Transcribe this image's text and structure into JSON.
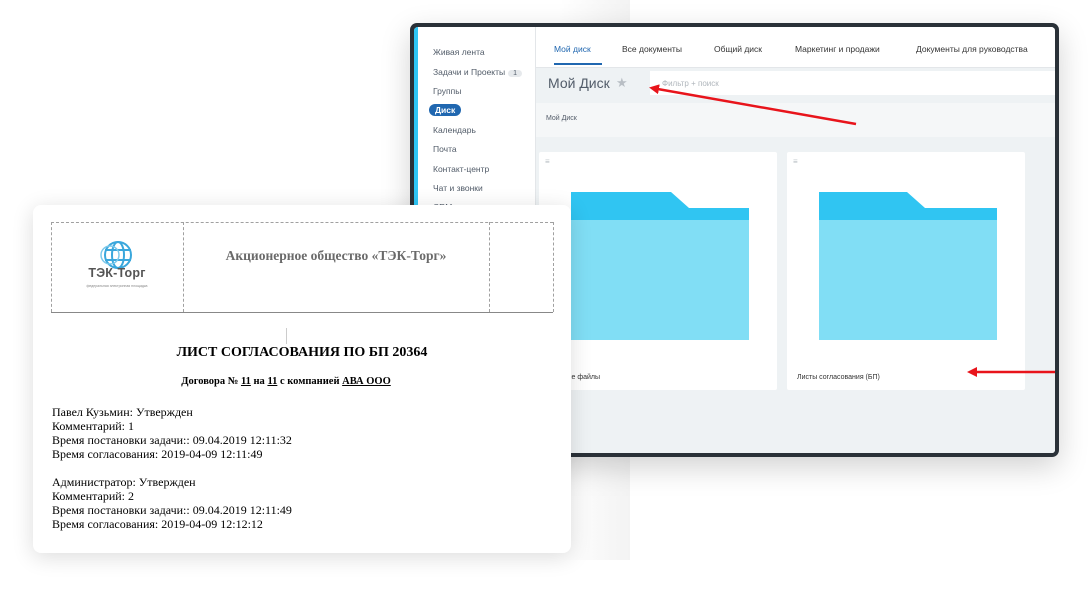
{
  "sidebar": {
    "items": [
      {
        "label": "Живая лента"
      },
      {
        "label": "Задачи и Проекты",
        "counter": "1"
      },
      {
        "label": "Группы"
      },
      {
        "label": "Диск",
        "active": true
      },
      {
        "label": "Календарь"
      },
      {
        "label": "Почта"
      },
      {
        "label": "Контакт-центр"
      },
      {
        "label": "Чат и звонки"
      },
      {
        "label": "CRM"
      }
    ]
  },
  "tabs": [
    {
      "label": "Мой диск",
      "active": true
    },
    {
      "label": "Все документы"
    },
    {
      "label": "Общий диск"
    },
    {
      "label": "Маркетинг и продажи"
    },
    {
      "label": "Документы для руководства"
    }
  ],
  "page": {
    "title": "Мой Диск",
    "filter_placeholder": "Фильтр + поиск",
    "breadcrumb": "Мой Диск"
  },
  "folders": [
    {
      "label": "...енные файлы"
    },
    {
      "label": "Листы согласования (БП)"
    }
  ],
  "colors": {
    "accent": "#2067b0",
    "folder_front": "#81def5",
    "folder_back": "#30c5f2",
    "arrow": "#e8141b"
  },
  "document": {
    "company": "Акционерное общество «ТЭК-Торг»",
    "logo_text": "ТЭК-Торг",
    "logo_sub": "федеральная электронная площадка",
    "title": "ЛИСТ СОГЛАСОВАНИЯ ПО БП 20364",
    "subtitle": {
      "part1": "Договора №",
      "num": "11",
      "part2": "на",
      "num2": "11",
      "part3": "с компанией",
      "company": "АВА ООО"
    },
    "approvals": [
      {
        "status": "Павел Кузьмин: Утвержден",
        "comment": "Комментарий: 1",
        "set_time": "Время постановки задачи:: 09.04.2019 12:11:32",
        "approved_time": "Время согласования: 2019-04-09 12:11:49"
      },
      {
        "status": "Администратор: Утвержден",
        "comment": "Комментарий: 2",
        "set_time": "Время постановки задачи:: 09.04.2019 12:11:49",
        "approved_time": "Время согласования: 2019-04-09 12:12:12"
      }
    ]
  }
}
